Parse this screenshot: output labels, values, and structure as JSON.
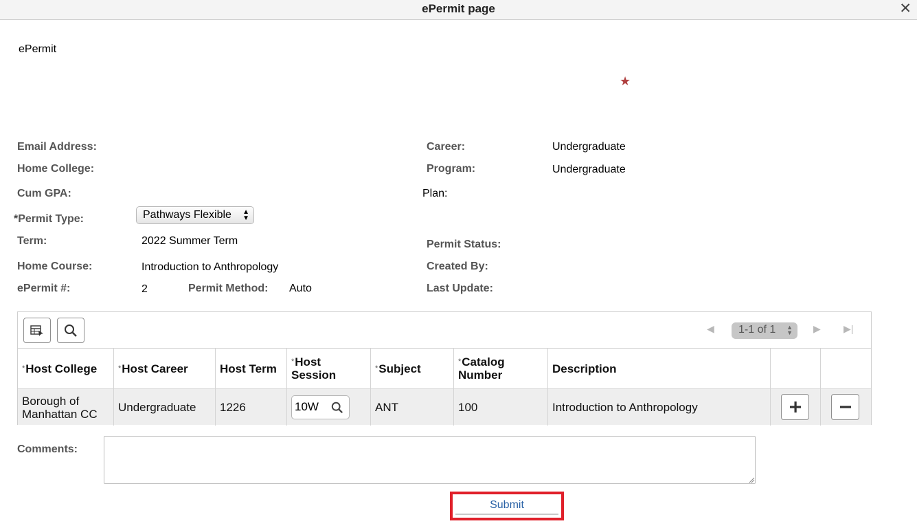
{
  "window": {
    "title": "ePermit page",
    "close_glyph": "✕"
  },
  "page": {
    "heading": "ePermit",
    "required_star": "★"
  },
  "fields": {
    "email_label": "Email Address:",
    "home_college_label": "Home College:",
    "cum_gpa_label": "Cum GPA:",
    "permit_type_required": "*",
    "permit_type_label": "Permit Type:",
    "permit_type_value": "Pathways Flexible",
    "term_label": "Term:",
    "term_value": "2022 Summer Term",
    "home_course_label": "Home Course:",
    "home_course_value": "Introduction to Anthropology",
    "epermit_number_label": "ePermit #:",
    "epermit_number_value": "2",
    "permit_method_label": "Permit Method:",
    "permit_method_value": "Auto",
    "career_label": "Career:",
    "career_value": "Undergraduate",
    "program_label": "Program:",
    "program_value": "Undergraduate",
    "plan_label": "Plan:",
    "permit_status_label": "Permit Status:",
    "created_by_label": "Created By:",
    "last_update_label": "Last Update:"
  },
  "grid": {
    "pager": {
      "range_text": "1-1 of 1"
    },
    "columns": [
      {
        "label": "Host College",
        "required": "*"
      },
      {
        "label": "Host Career",
        "required": "*"
      },
      {
        "label": "Host Term",
        "required": ""
      },
      {
        "label": "Host Session",
        "required": "*"
      },
      {
        "label": "Subject",
        "required": "*"
      },
      {
        "label": "Catalog Number",
        "required": "*"
      },
      {
        "label": "Description",
        "required": ""
      }
    ],
    "rows": [
      {
        "host_college": "Borough of Manhattan CC",
        "host_career": "Undergraduate",
        "host_term": "1226",
        "host_session": "10W",
        "subject": "ANT",
        "catalog_number": "100",
        "description": "Introduction to Anthropology"
      }
    ]
  },
  "comments": {
    "label": "Comments:",
    "value": ""
  },
  "actions": {
    "submit_label": "Submit"
  },
  "colors": {
    "accent_link": "#2a62a6",
    "highlight_frame": "#e0202a",
    "required_star": "#b04040"
  },
  "icons": [
    "close-icon",
    "grid-view-icon",
    "search-icon",
    "first-page-icon",
    "next-page-icon",
    "last-page-icon",
    "add-icon",
    "remove-icon"
  ]
}
